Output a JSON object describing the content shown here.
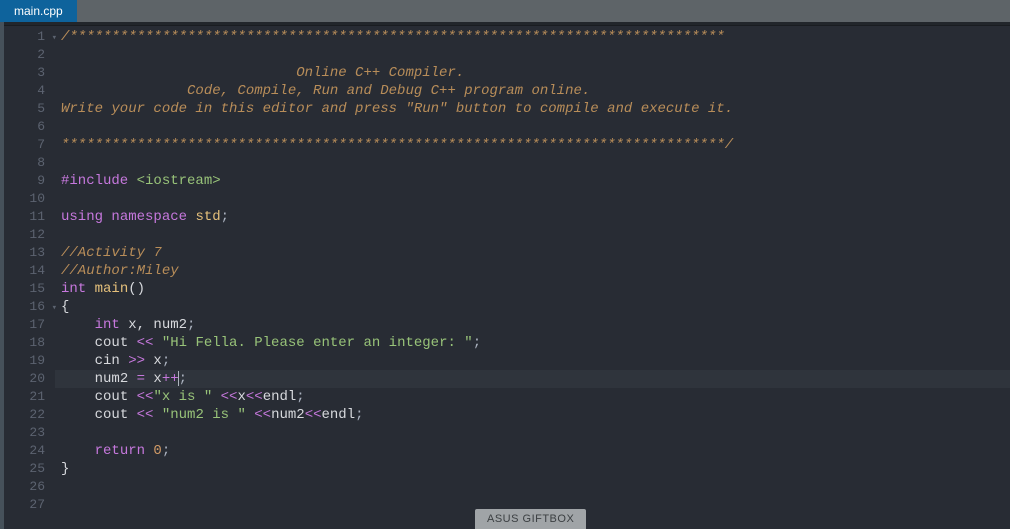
{
  "tab": {
    "filename": "main.cpp"
  },
  "gutter": {
    "lines": [
      "1",
      "2",
      "3",
      "4",
      "5",
      "6",
      "7",
      "8",
      "9",
      "10",
      "11",
      "12",
      "13",
      "14",
      "15",
      "16",
      "17",
      "18",
      "19",
      "20",
      "21",
      "22",
      "23",
      "24",
      "25",
      "26",
      "27"
    ],
    "fold_lines": [
      1,
      16
    ]
  },
  "code": {
    "l1": "/******************************************************************************",
    "l3_a": "                            Online C++ Compiler.",
    "l4_a": "               Code, Compile, Run and Debug C++ program online.",
    "l5_a": "Write your code in this editor and press \"Run\" button to compile and execute it.",
    "l7": "*******************************************************************************/",
    "l9_pp": "#include ",
    "l9_inc": "<iostream>",
    "l11_kw1": "using",
    "l11_kw2": " namespace ",
    "l11_id": "std",
    "l11_p": ";",
    "l13": "//Activity 7",
    "l14": "//Author:Miley",
    "l15_t": "int ",
    "l15_fn": "main",
    "l15_p": "()",
    "l16": "{",
    "l17_pad": "    ",
    "l17_t": "int ",
    "l17_v": "x, num2",
    "l17_p": ";",
    "l18_pad": "    ",
    "l18_a": "cout ",
    "l18_op": "<<",
    "l18_s": " \"Hi Fella. Please enter an integer: \"",
    "l18_p": ";",
    "l19_pad": "    ",
    "l19_a": "cin ",
    "l19_op": ">>",
    "l19_b": " x",
    "l19_p": ";",
    "l20_pad": "    ",
    "l20_a": "num2 ",
    "l20_op": "=",
    "l20_b": " x",
    "l20_op2": "++",
    "l20_p": ";",
    "l21_pad": "    ",
    "l21_a": "cout ",
    "l21_op": "<<",
    "l21_s": "\"x is \"",
    "l21_b": " ",
    "l21_op2": "<<",
    "l21_c": "x",
    "l21_op3": "<<",
    "l21_d": "endl",
    "l21_p": ";",
    "l22_pad": "    ",
    "l22_a": "cout ",
    "l22_op": "<<",
    "l22_sp": " ",
    "l22_s": "\"num2 is \"",
    "l22_b": " ",
    "l22_op2": "<<",
    "l22_c": "num2",
    "l22_op3": "<<",
    "l22_d": "endl",
    "l22_p": ";",
    "l24_pad": "    ",
    "l24_kw": "return ",
    "l24_n": "0",
    "l24_p": ";",
    "l25": "}"
  },
  "popup": {
    "label": "ASUS GIFTBOX"
  },
  "highlight_line": 20
}
